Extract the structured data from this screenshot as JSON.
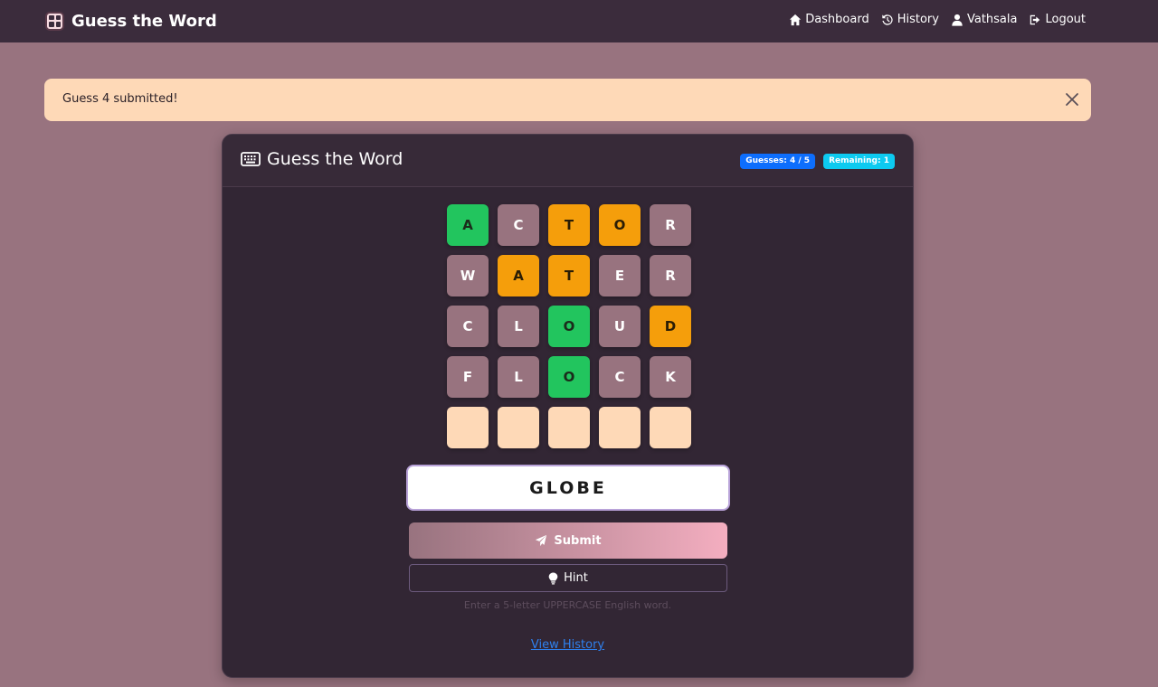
{
  "navbar": {
    "brand": "Guess the Word",
    "links": [
      {
        "label": "Dashboard",
        "icon": "home-icon"
      },
      {
        "label": "History",
        "icon": "history-icon"
      },
      {
        "label": "Vathsala",
        "icon": "user-icon"
      },
      {
        "label": "Logout",
        "icon": "logout-icon"
      }
    ]
  },
  "alert": {
    "message": "Guess 4 submitted!"
  },
  "card": {
    "title": "Guess the Word",
    "guesses_badge": "Guesses: 4 / 5",
    "remaining_badge": "Remaining: 1"
  },
  "board": {
    "rows": [
      [
        {
          "letter": "A",
          "state": "correct"
        },
        {
          "letter": "C",
          "state": "absent"
        },
        {
          "letter": "T",
          "state": "present"
        },
        {
          "letter": "O",
          "state": "present"
        },
        {
          "letter": "R",
          "state": "absent"
        }
      ],
      [
        {
          "letter": "W",
          "state": "absent"
        },
        {
          "letter": "A",
          "state": "present"
        },
        {
          "letter": "T",
          "state": "present"
        },
        {
          "letter": "E",
          "state": "absent"
        },
        {
          "letter": "R",
          "state": "absent"
        }
      ],
      [
        {
          "letter": "C",
          "state": "absent"
        },
        {
          "letter": "L",
          "state": "absent"
        },
        {
          "letter": "O",
          "state": "correct"
        },
        {
          "letter": "U",
          "state": "absent"
        },
        {
          "letter": "D",
          "state": "present"
        }
      ],
      [
        {
          "letter": "F",
          "state": "absent"
        },
        {
          "letter": "L",
          "state": "absent"
        },
        {
          "letter": "O",
          "state": "correct"
        },
        {
          "letter": "C",
          "state": "absent"
        },
        {
          "letter": "K",
          "state": "absent"
        }
      ],
      [
        {
          "letter": "",
          "state": "empty"
        },
        {
          "letter": "",
          "state": "empty"
        },
        {
          "letter": "",
          "state": "empty"
        },
        {
          "letter": "",
          "state": "empty"
        },
        {
          "letter": "",
          "state": "empty"
        }
      ]
    ]
  },
  "form": {
    "guess_value": "GLOBE",
    "submit_label": "Submit",
    "hint_label": "Hint",
    "help_text": "Enter a 5-letter UPPERCASE English word.",
    "history_link": "View History"
  },
  "colors": {
    "correct": "#22c55e",
    "present": "#f59e0b",
    "absent": "#98737f",
    "empty": "#fed9b7"
  }
}
